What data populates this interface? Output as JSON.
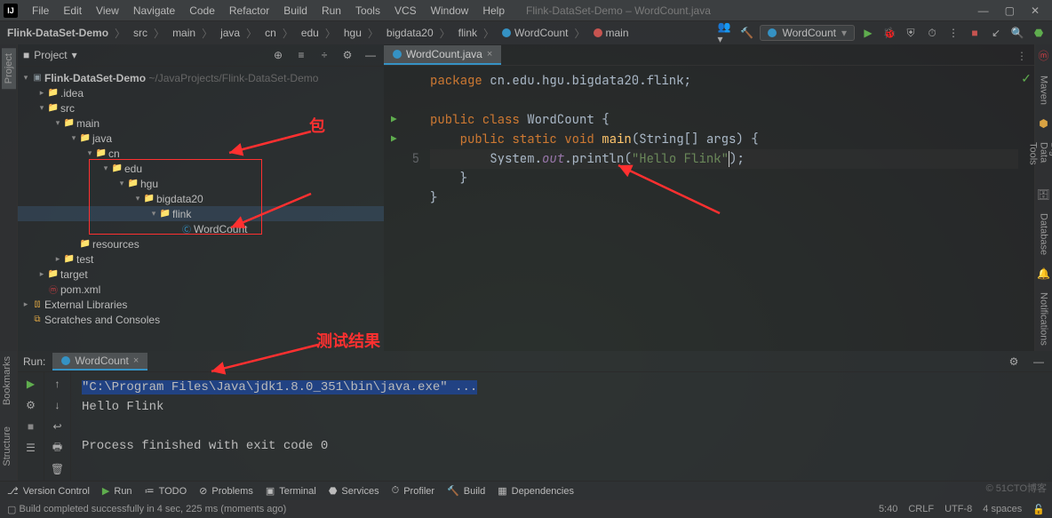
{
  "menu": {
    "file": "File",
    "edit": "Edit",
    "view": "View",
    "navigate": "Navigate",
    "code": "Code",
    "refactor": "Refactor",
    "build": "Build",
    "run": "Run",
    "tools": "Tools",
    "vcs": "VCS",
    "window": "Window",
    "help": "Help"
  },
  "windowTitle": "Flink-DataSet-Demo – WordCount.java",
  "breadcrumbs": [
    "Flink-DataSet-Demo",
    "src",
    "main",
    "java",
    "cn",
    "edu",
    "hgu",
    "bigdata20",
    "flink",
    "WordCount",
    "main"
  ],
  "runConfig": "WordCount",
  "project": {
    "panelTitle": "Project",
    "root": "Flink-DataSet-Demo",
    "rootHint": "~/JavaProjects/Flink-DataSet-Demo",
    "items": {
      "idea": ".idea",
      "src": "src",
      "main": "main",
      "java": "java",
      "cn": "cn",
      "edu": "edu",
      "hgu": "hgu",
      "bigdata20": "bigdata20",
      "flink": "flink",
      "wordcount": "WordCount",
      "resources": "resources",
      "test": "test",
      "target": "target",
      "pom": "pom.xml",
      "extlib": "External Libraries",
      "scratch": "Scratches and Consoles"
    }
  },
  "tab": {
    "name": "WordCount.java"
  },
  "code": {
    "l1a": "package ",
    "l1b": "cn.edu.hgu.bigdata20.flink",
    "l3a": "public class ",
    "l3b": "WordCount {",
    "l4a": "public static void ",
    "l4b": "main",
    "l4c": "(String[] args) {",
    "l5a": "System.",
    "l5b": "out",
    "l5c": ".",
    "l5d": "println",
    "l5e": "(",
    "l5f": "\"Hello Flink\"",
    "l5g": ");",
    "l6": "}",
    "l7": "}",
    "ln5": "5"
  },
  "run": {
    "title": "Run:",
    "tab": "WordCount",
    "cmd": "\"C:\\Program Files\\Java\\jdk1.8.0_351\\bin\\java.exe\" ...",
    "out": "Hello Flink",
    "exit": "Process finished with exit code 0"
  },
  "bottom": {
    "vc": "Version Control",
    "run": "Run",
    "todo": "TODO",
    "problems": "Problems",
    "terminal": "Terminal",
    "services": "Services",
    "profiler": "Profiler",
    "build": "Build",
    "deps": "Dependencies"
  },
  "status": {
    "msg": "Build completed successfully in 4 sec, 225 ms (moments ago)",
    "pos": "5:40",
    "crlf": "CRLF",
    "enc": "UTF-8",
    "indent": "4 spaces"
  },
  "sidetabs": {
    "project": "Project",
    "bookmarks": "Bookmarks",
    "structure": "Structure",
    "maven": "Maven",
    "bigdata": "Big Data Tools",
    "database": "Database",
    "notif": "Notifications"
  },
  "annotations": {
    "pkg": "包",
    "test": "测试结果"
  },
  "watermark": "© 51CTO博客"
}
